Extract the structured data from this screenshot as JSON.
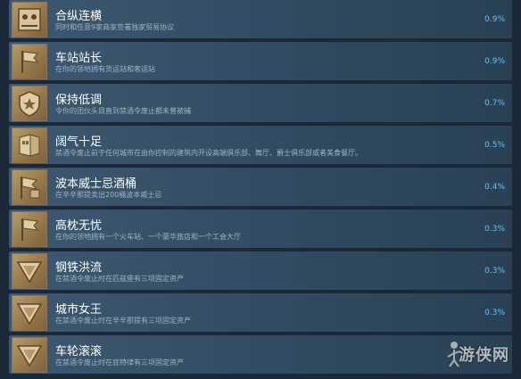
{
  "achievements": [
    {
      "title": "合纵连横",
      "desc": "同时和任意9家商家签署独家贸易协议",
      "pct": "0.9%",
      "icon": "handshake-icon"
    },
    {
      "title": "车站站长",
      "desc": "在你的领地拥有货运站和客运站",
      "pct": "0.9%",
      "icon": "flag-icon"
    },
    {
      "title": "保持低调",
      "desc": "令你的团伙头目直到禁酒令废止都未曾被捕",
      "pct": "0.7%",
      "icon": "badge-icon"
    },
    {
      "title": "阔气十足",
      "desc": "禁酒令废止前于任何城市在由你控制的建筑内开设高端俱乐部、舞厅、爵士俱乐部或者美食餐厅。",
      "pct": "0.5%",
      "icon": "building-icon"
    },
    {
      "title": "波本威士忌酒桶",
      "desc": "在辛辛那提卖出200桶波本威士忌",
      "pct": "0.4%",
      "icon": "flag-icon"
    },
    {
      "title": "高枕无忧",
      "desc": "在你的领地拥有一个火车站、一个豪华旅店和一个工会大厅",
      "pct": "0.3%",
      "icon": "flag-icon"
    },
    {
      "title": "钢铁洪流",
      "desc": "在禁酒令废止时在匹兹堡有三项固定资产",
      "pct": "0.3%",
      "icon": "triangle-icon"
    },
    {
      "title": "城市女王",
      "desc": "在禁酒令废止时在辛辛那提有三项固定资产",
      "pct": "0.3%",
      "icon": "triangle-icon"
    },
    {
      "title": "车轮滚滚",
      "desc": "在禁酒令废止时在底特律有三项固定资产",
      "pct": "0.3%",
      "icon": "triangle-icon"
    }
  ],
  "watermark": {
    "text": "游侠网"
  }
}
